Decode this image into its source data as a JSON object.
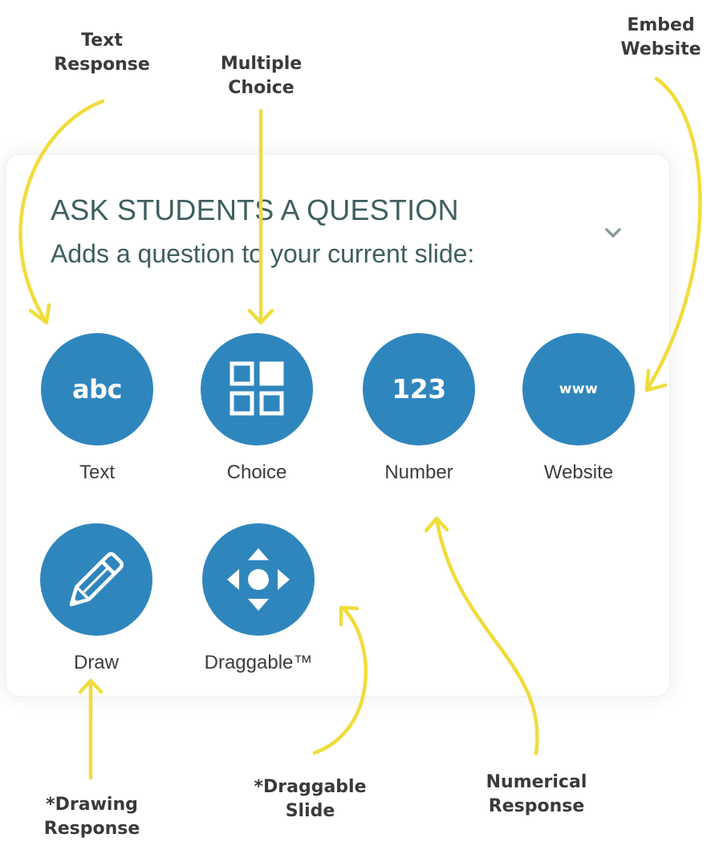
{
  "panel": {
    "title": "ASK STUDENTS A QUESTION",
    "subtitle": "Adds a question to your current slide:",
    "toggle_icon": "chevron-down-icon"
  },
  "question_types": [
    {
      "id": "text",
      "label": "Text",
      "icon": "abc-icon",
      "icon_text": "abc"
    },
    {
      "id": "choice",
      "label": "Choice",
      "icon": "grid-icon"
    },
    {
      "id": "number",
      "label": "Number",
      "icon": "123-icon",
      "icon_text": "123"
    },
    {
      "id": "website",
      "label": "Website",
      "icon": "www-icon",
      "icon_text": "www"
    },
    {
      "id": "draw",
      "label": "Draw",
      "icon": "pencil-icon"
    },
    {
      "id": "draggable",
      "label": "Draggable™",
      "icon": "move-arrows-icon"
    }
  ],
  "annotations": {
    "text_response": [
      "Text",
      "Response"
    ],
    "multiple_choice": [
      "Multiple",
      "Choice"
    ],
    "embed_website": [
      "Embed",
      "Website"
    ],
    "drawing_response": [
      "*Drawing",
      "Response"
    ],
    "draggable_slide": [
      "*Draggable",
      "Slide"
    ],
    "numerical_response": [
      "Numerical",
      "Response"
    ]
  },
  "colors": {
    "button_fill": "#2f86bd",
    "annotation_arrow": "#f0dc3c",
    "heading_text": "#3f5f5f",
    "label_text": "#3c3c3c"
  }
}
